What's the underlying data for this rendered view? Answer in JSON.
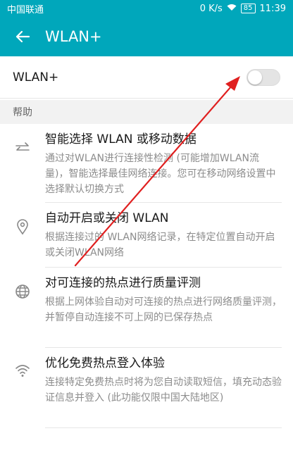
{
  "status_bar": {
    "carrier": "中国联通",
    "speed": "0 K/s",
    "battery": "85",
    "time": "11:39"
  },
  "app_bar": {
    "title": "WLAN+"
  },
  "toggle": {
    "label": "WLAN+",
    "enabled": false
  },
  "help": {
    "header": "帮助",
    "items": [
      {
        "title": "智能选择 WLAN 或移动数据",
        "desc": "通过对WLAN进行连接性检测 (可能增加WLAN流量)，智能选择最佳网络连接。您可在移动网络设置中选择默认切换方式",
        "icon": "swap-arrows-icon"
      },
      {
        "title": "自动开启或关闭 WLAN",
        "desc": "根据连接过的 WLAN网络记录，在特定位置自动开启或关闭WLAN网络",
        "icon": "location-pin-icon"
      },
      {
        "title": "对可连接的热点进行质量评测",
        "desc": "根据上网体验自动对可连接的热点进行网络质量评测，并暂停自动连接不可上网的已保存热点",
        "icon": "globe-icon"
      },
      {
        "title": "优化免费热点登入体验",
        "desc": "连接特定免费热点时将为您自动读取短信，填充动态验证信息并登入 (此功能仅限中国大陆地区)",
        "icon": "wifi-icon"
      }
    ]
  },
  "colors": {
    "accent": "#00a7bb",
    "annotation_arrow": "#e02020"
  }
}
